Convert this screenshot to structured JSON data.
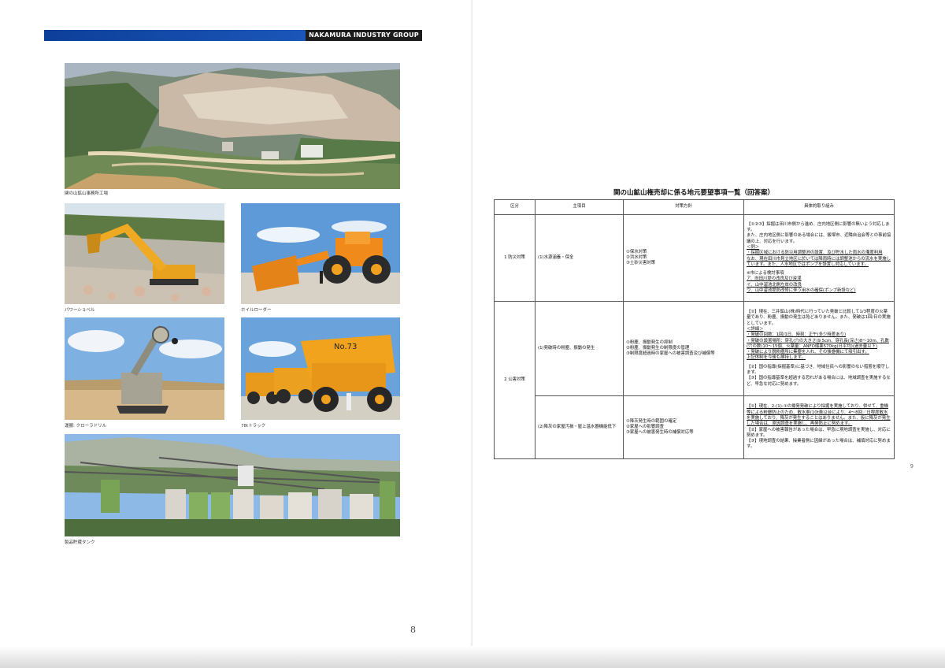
{
  "header": {
    "group_name": "NAKAMURA INDUSTRY GROUP"
  },
  "photos": [
    {
      "caption": "関の山鉱山事務所工場",
      "scene": "quarry-aerial"
    },
    {
      "caption": "パワーショベル",
      "scene": "power-shovel"
    },
    {
      "caption": "ホイルローダー",
      "scene": "wheel-loader"
    },
    {
      "caption": "運搬: クローラドリル",
      "scene": "crawler-drill"
    },
    {
      "caption": "78tトラック",
      "scene": "dump-truck"
    },
    {
      "caption": "製品貯蔵タンク",
      "scene": "storage-tanks"
    }
  ],
  "table": {
    "title": "関の山鉱山権売却に係る地元要望事項一覧（回答案）",
    "headers": [
      "区分",
      "主項目",
      "対策方針",
      "具体的取り組み"
    ],
    "rows": [
      {
        "category": "1 防災対策",
        "item": "(1)水源涵養・保全",
        "policy": [
          "①保水対策",
          "②洪水対策",
          "③土砂災害対策"
        ],
        "detail": [
          "【①②③】採掘は田川市側から進め、庄内地区側に影響の無いよう対応します。",
          "また、庄内地区側に影響のある場合には、飯塚市、近隣自治会等との事前協議の上、対応を行います。",
          "＜例＞",
          "・採掘区域における防災用調整池の設置、及び貯水した雨水の濁度利用",
          "なお、現在田川市見立地区に於いては降雨時には調整池からの流水を実施しています。また、人水地区ではポンプを設置し対応しています。",
          "",
          "※市による検討事項",
          "ア、向田川堤の改良及び浚渫",
          "イ、山中溜池北側左岸の改良",
          "ウ、山中溜池堤防改修に伴う用水の確保(ポンプ新設など)"
        ]
      },
      {
        "category": "2 公害対策",
        "item": "(1)発破時の粉塵、振動の発生",
        "policy": [
          "①粉塵、振動発生の抑制",
          "②粉塵、振動発生の制限度の管理",
          "③制限度超過時の家屋への被害調査及び補償等"
        ],
        "detail": [
          "【①】現在、三井鉱山(株)時代に行っていた発破と比較して1/3程度の火薬量であり、粉塵、振動の発生は殆どありません。また、発破は1回/日の実施としています。",
          "＜詳細＞",
          "・発破の回数：1回/1日、時刻：正午(多少時差あり)",
          "・発破の設置場所：穿孔(穴の大きさ)9.5cm、穿孔長(深さ)8〜10m、孔数(穴の数)10〜15個、火薬量：ANFO爆薬570kg(日平均)(過去量以下)",
          "・発破により脱粉塵所に集塵を入れ、その後巻機にて吸引出す。",
          "上記体制を今後も維持します。",
          "",
          "【②】国の指導(採掘基準)に基づき、地域住民への影響のない措置を順守します。",
          "【③】国の指導基準を超過する恐れがある場合には、地域調査を実施するなど、早急な対応に努めます。"
        ]
      },
      {
        "category": "",
        "item": "(2)降灰の家屋汚損・屋上温水器機能低下",
        "policy": [
          "①降灰発生時の範囲の確定",
          "②家屋への影響調査",
          "③家屋への被害発生時の補償対応等"
        ],
        "detail": [
          "【①】現在、2-(1)-①の揚発発破により採掘を実施しており、併せて、重機等による粉塵防止のため、散水車(10t車)2台により、4〜8回／日程度散水を実施しており、降灰が発生することはありません。また、仮に降灰が発生した場合は、原因調査を実施し、再発防止に努めます。",
          "【②】家屋への被害報告があった場合は、早急に現地調査を実施し、対応に努めます。",
          "【③】現地調査の結果、操業者側に因縁があった場合は、補填対応に努めます。"
        ]
      }
    ]
  },
  "page_numbers": {
    "left": "8",
    "right": "9"
  }
}
